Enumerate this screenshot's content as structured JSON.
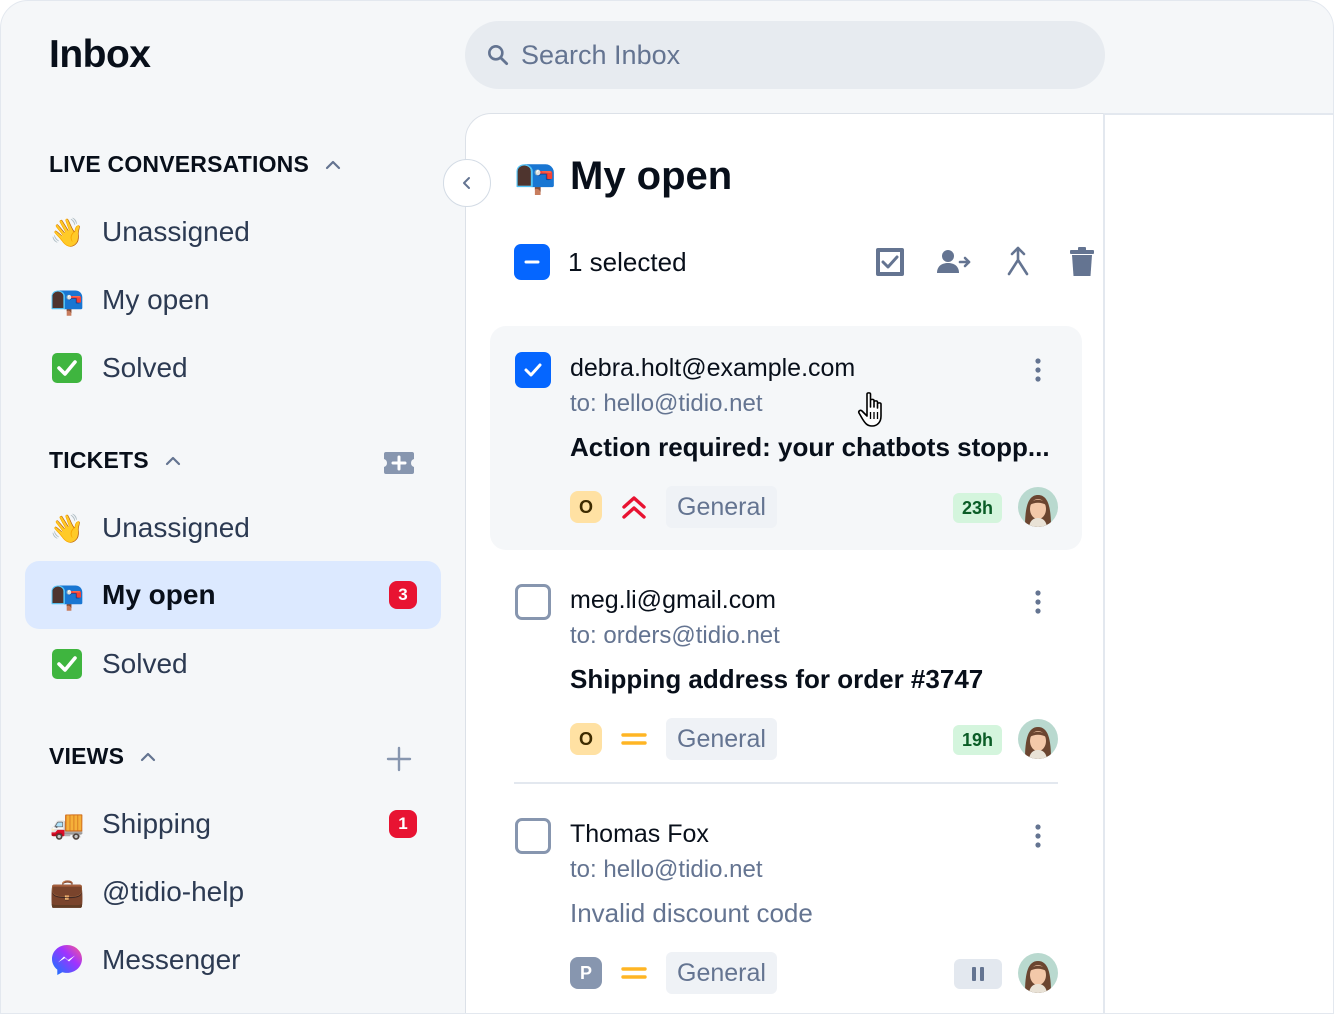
{
  "app": {
    "title": "Inbox"
  },
  "search": {
    "placeholder": "Search Inbox"
  },
  "sidebar": {
    "live": {
      "header": "LIVE CONVERSATIONS",
      "items": [
        {
          "emoji": "👋",
          "label": "Unassigned"
        },
        {
          "emoji": "📭",
          "label": "My open"
        },
        {
          "emoji": "✅",
          "label": "Solved"
        }
      ]
    },
    "tickets": {
      "header": "TICKETS",
      "items": [
        {
          "emoji": "👋",
          "label": "Unassigned"
        },
        {
          "emoji": "📭",
          "label": "My open",
          "badge": "3",
          "active": true
        },
        {
          "emoji": "✅",
          "label": "Solved"
        }
      ]
    },
    "views": {
      "header": "VIEWS",
      "items": [
        {
          "emoji": "🚚",
          "label": "Shipping",
          "badge": "1"
        },
        {
          "emoji": "💼",
          "label": "@tidio-help"
        },
        {
          "emoji": "messenger-icon",
          "label": "Messenger"
        }
      ]
    }
  },
  "panel": {
    "emoji": "📭",
    "title": "My open",
    "selection_text": "1 selected"
  },
  "tickets": [
    {
      "from": "debra.holt@example.com",
      "to": "to: hello@tidio.net",
      "subject": "Action required: your chatbots stopp...",
      "status": "O",
      "priority": "urgent",
      "tag": "General",
      "time": "23h",
      "selected": true
    },
    {
      "from": "meg.li@gmail.com",
      "to": "to: orders@tidio.net",
      "subject": "Shipping address for order #3747",
      "status": "O",
      "priority": "medium",
      "tag": "General",
      "time": "19h",
      "selected": false
    },
    {
      "from": "Thomas Fox",
      "to": "to: hello@tidio.net",
      "subject": "Invalid discount code",
      "status": "P",
      "priority": "medium",
      "tag": "General",
      "time": "paused",
      "selected": false
    }
  ],
  "colors": {
    "accent": "#0566ff",
    "badge": "#e81332",
    "active_bg": "#dce9ff",
    "urgent": "#e81332",
    "medium": "#ffb524"
  }
}
